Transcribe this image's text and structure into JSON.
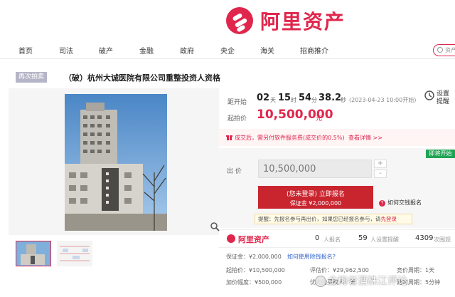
{
  "brand": {
    "name": "阿里资产",
    "color": "#e0264c"
  },
  "nav": {
    "items": [
      "首页",
      "司法",
      "破产",
      "金融",
      "政府",
      "央企",
      "海关",
      "招商推介"
    ],
    "search_placeholder": "资产"
  },
  "listing": {
    "badge": "再次拍卖",
    "title": "（破）杭州大诚医院有限公司重整投资人资格"
  },
  "countdown": {
    "label": "距开始",
    "days": "02",
    "days_unit": "天",
    "hours": "15",
    "hours_unit": "时",
    "minutes": "54",
    "minutes_unit": "分",
    "seconds": "38.2",
    "seconds_unit": "秒",
    "start_note": "(2023-04-23 10:00开始)"
  },
  "reminder": {
    "line1": "设置",
    "line2": "提醒"
  },
  "start_price": {
    "label": "起拍价",
    "value": "10,500,000",
    "unit": "元"
  },
  "notice": {
    "text": "成交后，需另付软件服务费(成交价的0.5%)",
    "link": "查看详情 >>"
  },
  "bid": {
    "tag": "即将开始",
    "label": "出 价",
    "input_value": "10,500,000",
    "plus": "+",
    "minus": "-",
    "button_line1": "(您未登录) 立即报名",
    "button_line2": "保证金 ¥2,000,000",
    "how_pay_icon": "?",
    "how_pay": "如何交钱报名",
    "tip_prefix": "提醒：先报名参与再出价，如果您已经报名参与，请",
    "tip_link": "先登录"
  },
  "stats": {
    "brand": "阿里资产",
    "signups": "0",
    "signups_label": "人报名",
    "reminders": "59",
    "reminders_label": "人设置提醒",
    "views": "4309",
    "views_label": "次围观"
  },
  "details": {
    "deposit": "保证金：¥2,000,000",
    "deposit_link": "如何使用除钱报名?",
    "start_price": "起拍价：¥10,500,000",
    "increment": "加价幅度：¥500,000",
    "appraisal": "评估价：¥29,962,500",
    "priority": "优先购买权人：无",
    "period_left": "竞价周期：1天",
    "period_right": "延时周期：5分钟"
  },
  "watermark": "金梅者酒株江评论"
}
